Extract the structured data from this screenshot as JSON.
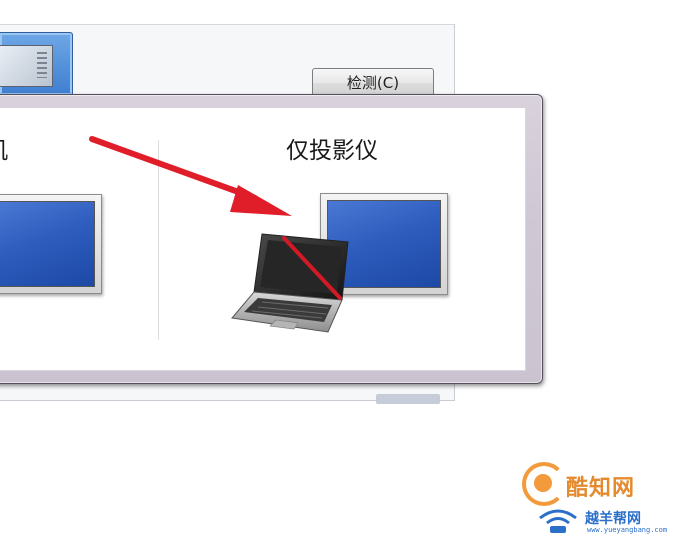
{
  "background_window": {
    "detect_button_label": "检测(C)"
  },
  "projection_switcher": {
    "options": [
      {
        "label": "机",
        "icon": "monitor-icon"
      },
      {
        "label": "仅投影仪",
        "icon": "projector-only-icon"
      }
    ]
  },
  "watermark": {
    "brand_text": "酷知网",
    "site_text": "越羊帮网",
    "site_url": "www.yueyangbang.com"
  },
  "colors": {
    "arrow": "#e01e2a",
    "screen_blue": "#2e5dbe",
    "frame": "#cfc7d4"
  }
}
